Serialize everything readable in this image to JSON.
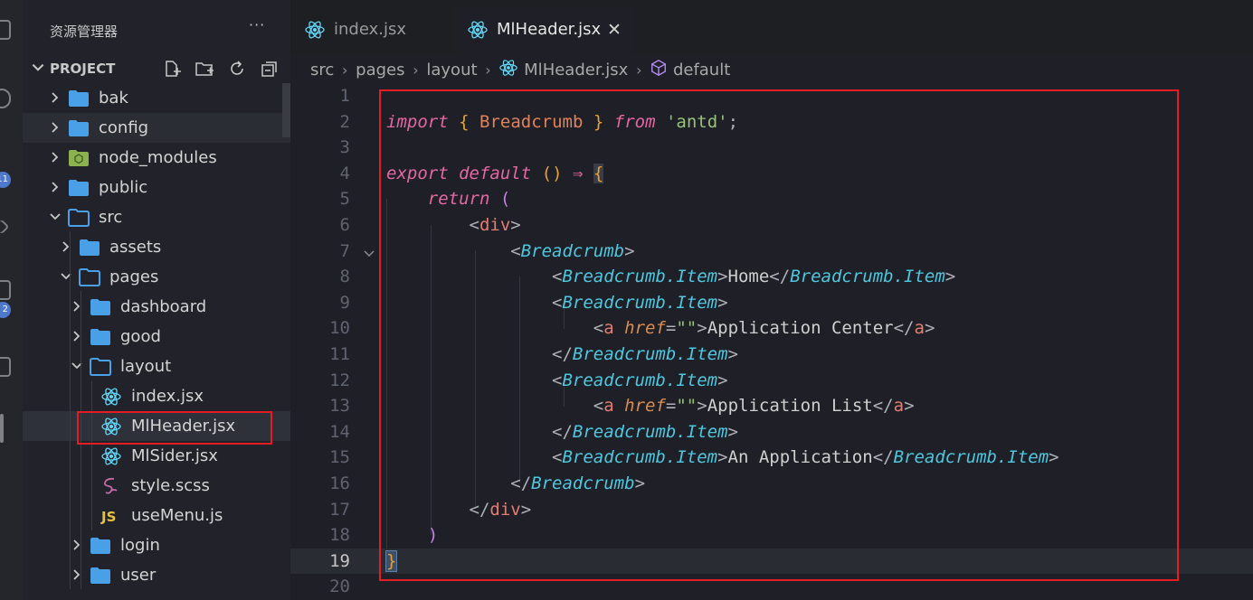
{
  "colors": {
    "sidebar_bg": "#21222a",
    "editor_bg": "#1f2027",
    "accent_red_box": "#e51c23",
    "react_icon": "#61dafb",
    "folder_blue": "#4aa0e6"
  },
  "activity_bar": {
    "badges": [
      "11",
      "2"
    ]
  },
  "sidebar": {
    "title": "资源管理器",
    "more": "···",
    "project": {
      "label": "PROJECT",
      "actions": [
        "new-file-icon",
        "new-folder-icon",
        "refresh-icon",
        "collapse-all-icon"
      ]
    },
    "tree": [
      {
        "label": "bak",
        "type": "folder",
        "expanded": false,
        "depth": 0
      },
      {
        "label": "config",
        "type": "folder",
        "expanded": false,
        "depth": 0
      },
      {
        "label": "node_modules",
        "type": "node-folder",
        "expanded": false,
        "depth": 0
      },
      {
        "label": "public",
        "type": "folder",
        "expanded": false,
        "depth": 0
      },
      {
        "label": "src",
        "type": "folder",
        "expanded": true,
        "depth": 0
      },
      {
        "label": "assets",
        "type": "folder",
        "expanded": false,
        "depth": 1
      },
      {
        "label": "pages",
        "type": "folder",
        "expanded": true,
        "depth": 1
      },
      {
        "label": "dashboard",
        "type": "folder",
        "expanded": false,
        "depth": 2
      },
      {
        "label": "good",
        "type": "folder",
        "expanded": false,
        "depth": 2
      },
      {
        "label": "layout",
        "type": "folder",
        "expanded": true,
        "depth": 2
      },
      {
        "label": "index.jsx",
        "type": "react",
        "depth": 3
      },
      {
        "label": "MlHeader.jsx",
        "type": "react",
        "depth": 3,
        "selected": true
      },
      {
        "label": "MlSider.jsx",
        "type": "react",
        "depth": 3
      },
      {
        "label": "style.scss",
        "type": "sass",
        "depth": 3
      },
      {
        "label": "useMenu.js",
        "type": "js",
        "depth": 3
      },
      {
        "label": "login",
        "type": "folder",
        "expanded": false,
        "depth": 2
      },
      {
        "label": "user",
        "type": "folder",
        "expanded": false,
        "depth": 2
      }
    ]
  },
  "tabs": [
    {
      "label": "index.jsx",
      "active": false
    },
    {
      "label": "MlHeader.jsx",
      "active": true,
      "close": "✕"
    }
  ],
  "breadcrumb": {
    "parts": [
      "src",
      "pages",
      "layout",
      "MlHeader.jsx",
      "default"
    ],
    "sep": "›"
  },
  "editor": {
    "current_line": 19,
    "line_numbers": [
      "1",
      "2",
      "3",
      "4",
      "5",
      "6",
      "7",
      "8",
      "9",
      "10",
      "11",
      "12",
      "13",
      "14",
      "15",
      "16",
      "17",
      "18",
      "19",
      "20"
    ],
    "code": {
      "l2": {
        "kw_import": "import",
        "brace_open": "{",
        "ident": "Breadcrumb",
        "brace_close": "}",
        "kw_from": "from",
        "str": "'antd'",
        "semi": ";"
      },
      "l4": {
        "kw_export": "export",
        "kw_default": "default",
        "parens": "()",
        "arrow": "⇒",
        "brace": "{"
      },
      "l5": {
        "kw_return": "return",
        "paren": "("
      },
      "l6": {
        "lt": "<",
        "tag": "div",
        "gt": ">"
      },
      "l7": {
        "lt": "<",
        "comp": "Breadcrumb",
        "gt": ">"
      },
      "l8": {
        "lt": "<",
        "comp": "Breadcrumb.Item",
        "gt": ">",
        "text": "Home",
        "lt_close": "</",
        "comp_close": "Breadcrumb.Item",
        "gt_close": ">"
      },
      "l9": {
        "lt": "<",
        "comp": "Breadcrumb.Item",
        "gt": ">"
      },
      "l10": {
        "lt": "<",
        "tag": "a",
        "attr": "href",
        "eq": "=",
        "val": "\"\"",
        "gt": ">",
        "text": "Application Center",
        "lt_close": "</",
        "tag_close": "a",
        "gt_close": ">"
      },
      "l11": {
        "lt": "</",
        "comp": "Breadcrumb.Item",
        "gt": ">"
      },
      "l12": {
        "lt": "<",
        "comp": "Breadcrumb.Item",
        "gt": ">"
      },
      "l13": {
        "lt": "<",
        "tag": "a",
        "attr": "href",
        "eq": "=",
        "val": "\"\"",
        "gt": ">",
        "text": "Application List",
        "lt_close": "</",
        "tag_close": "a",
        "gt_close": ">"
      },
      "l14": {
        "lt": "</",
        "comp": "Breadcrumb.Item",
        "gt": ">"
      },
      "l15": {
        "lt": "<",
        "comp": "Breadcrumb.Item",
        "gt": ">",
        "text": "An Application",
        "lt_close": "</",
        "comp_close": "Breadcrumb.Item",
        "gt_close": ">"
      },
      "l16": {
        "lt": "</",
        "comp": "Breadcrumb",
        "gt": ">"
      },
      "l17": {
        "lt": "</",
        "tag": "div",
        "gt": ">"
      },
      "l18": {
        "paren": ")"
      },
      "l19": {
        "brace": "}"
      }
    }
  }
}
